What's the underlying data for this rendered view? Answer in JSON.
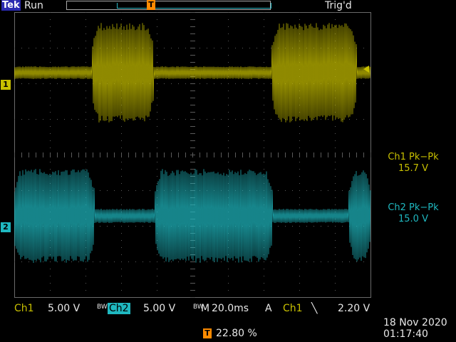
{
  "header": {
    "brand": "Tek",
    "run_state": "Run",
    "trigger_state": "Trig'd",
    "trigger_marker": "T"
  },
  "channels": {
    "ch1": {
      "marker": "1",
      "color": "#c8c000"
    },
    "ch2": {
      "marker": "2",
      "color": "#1fb8c0"
    }
  },
  "measurements": [
    {
      "label": "Ch1 Pk−Pk",
      "value": "15.7 V"
    },
    {
      "label": "Ch2 Pk−Pk",
      "value": "15.0 V"
    }
  ],
  "footer": {
    "ch1_label": "Ch1",
    "ch1_scale": "5.00 V",
    "bw1": "BW",
    "ch2_label": "Ch2",
    "ch2_scale": "5.00 V",
    "bw2": "BW",
    "timebase_label": "M",
    "timebase": "20.0ms",
    "trigger_mode": "A",
    "trigger_source": "Ch1",
    "trigger_slope": "╲",
    "trigger_level": "2.20 V",
    "horizontal_position": "22.80 %",
    "date": "18 Nov 2020",
    "time": "01:17:40"
  },
  "colors": {
    "ch1": "#c8c000",
    "ch2": "#1fb8c0",
    "trigger": "#ff8a00",
    "graticule": "#5a5a5a"
  }
}
